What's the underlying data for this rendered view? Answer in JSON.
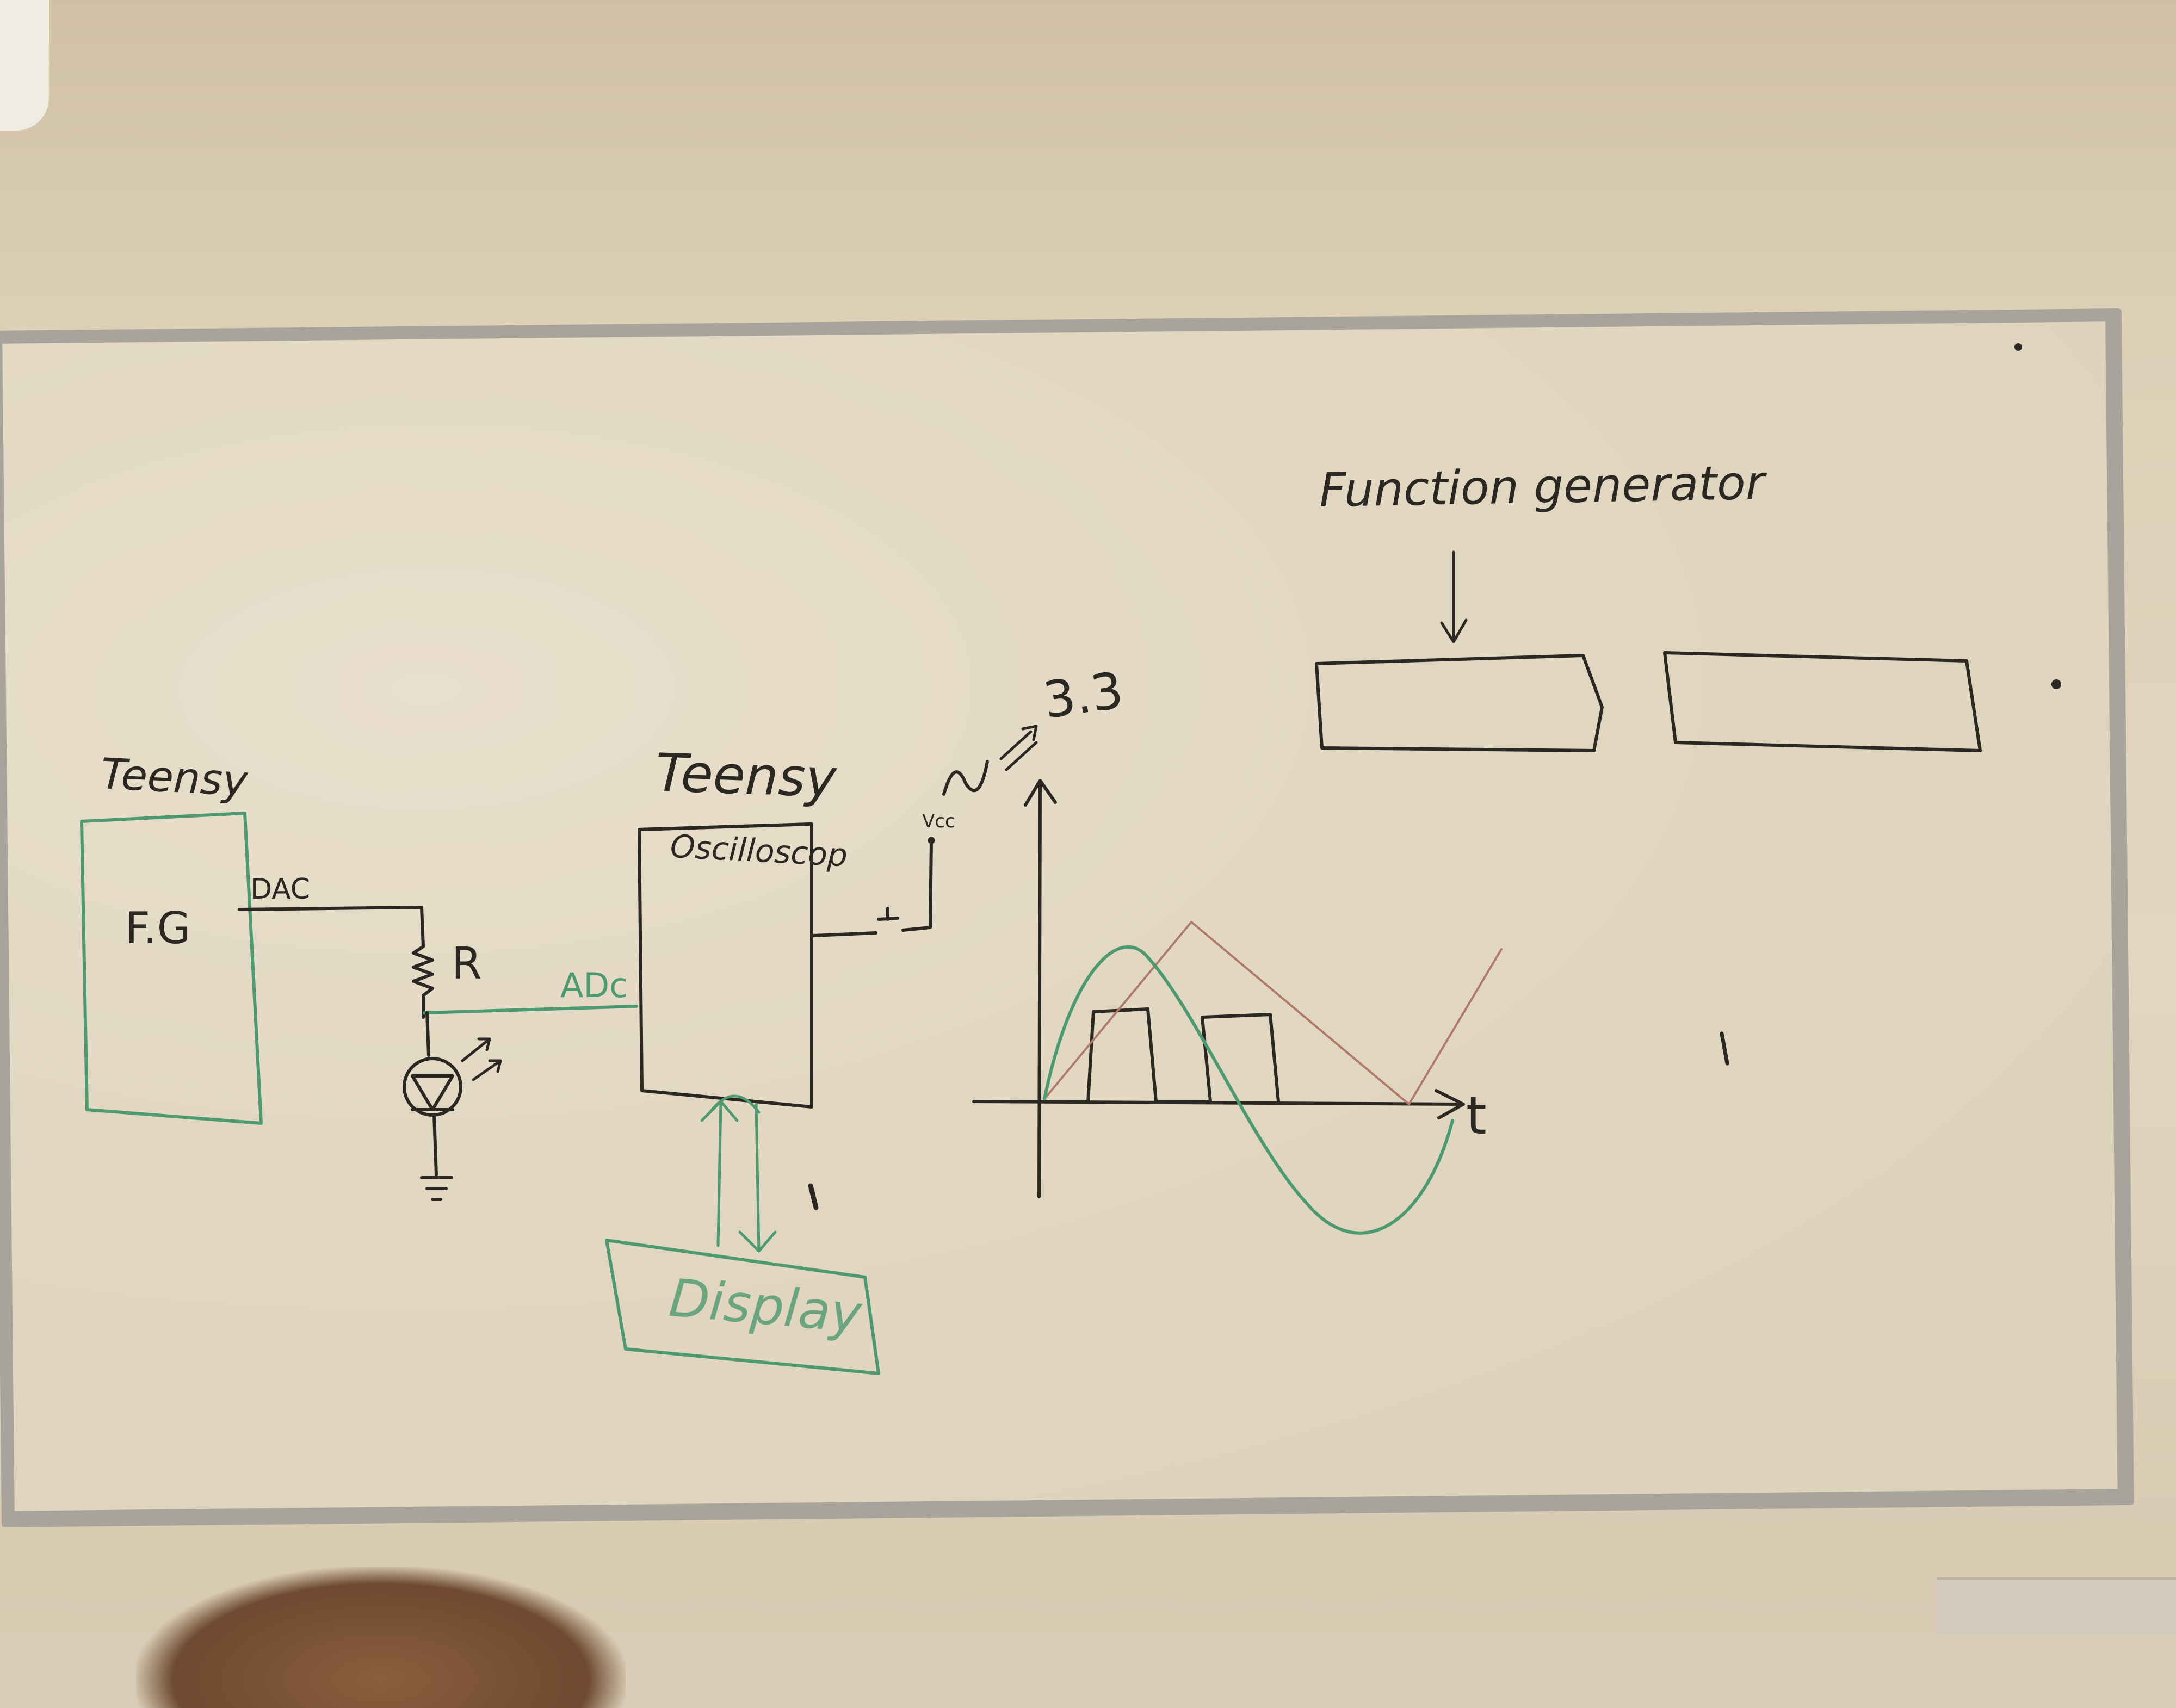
{
  "scene": "whiteboard",
  "labels": {
    "teensy_left": "Teensy",
    "fg": "F.G",
    "dac": "DAC",
    "resistor": "R",
    "adc": "ADc",
    "teensy_center": "Teensy",
    "oscilloscope": "Oscilloscop",
    "display": "Display",
    "vcc": "Vcc",
    "approx_value": "3.3",
    "time_axis": "t",
    "function_generator": "Function generator"
  },
  "colors": {
    "marker_black": "#2b2722",
    "marker_green": "#4e9a70",
    "marker_red": "#b07a6a"
  }
}
